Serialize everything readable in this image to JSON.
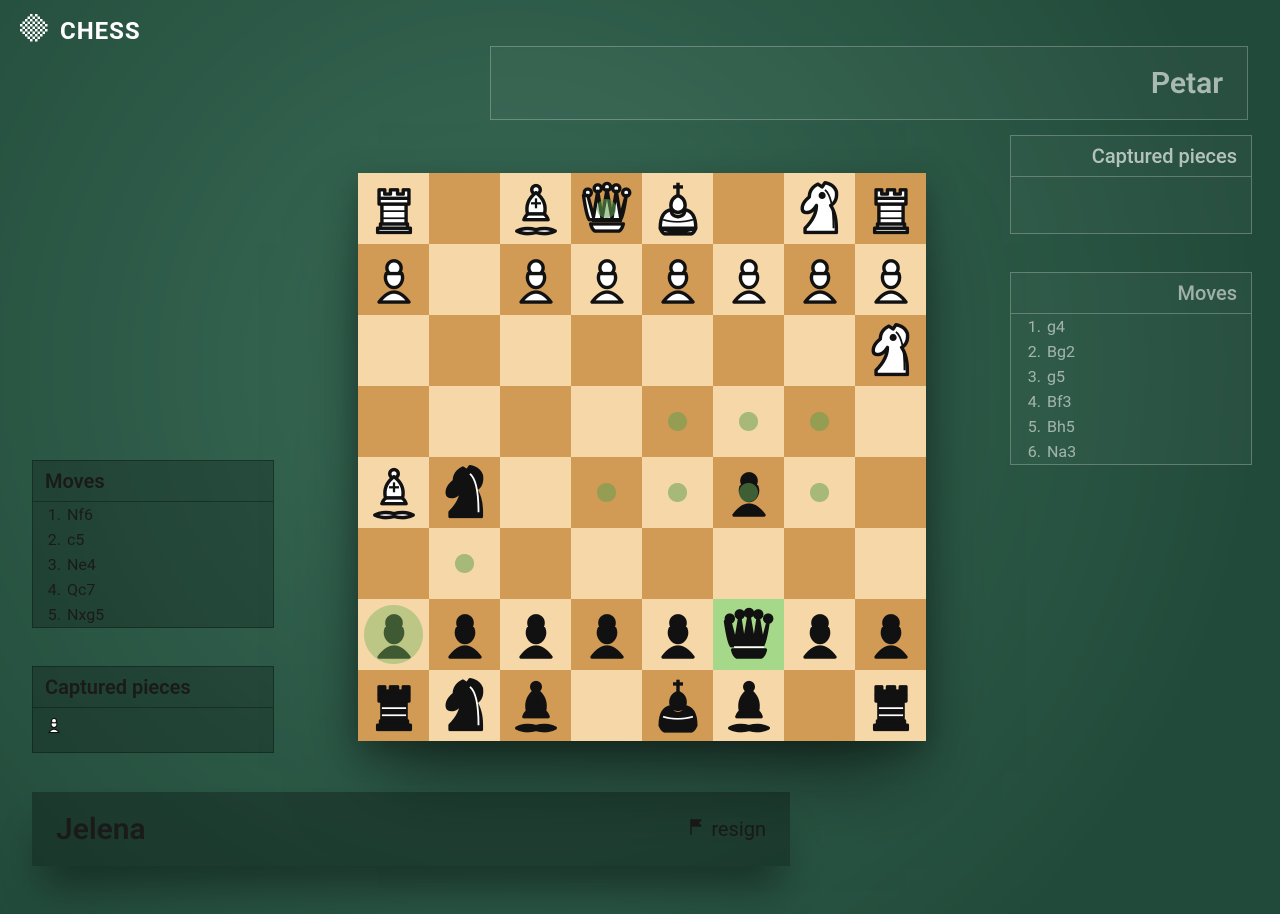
{
  "app": {
    "title": "CHESS"
  },
  "opponent": {
    "name": "Petar",
    "captured_header": "Captured pieces",
    "moves_header": "Moves",
    "moves": [
      "g4",
      "Bg2",
      "g5",
      "Bf3",
      "Bh5",
      "Na3"
    ]
  },
  "player": {
    "name": "Jelena",
    "resign_label": "resign",
    "moves_header": "Moves",
    "moves": [
      "Nf6",
      "c5",
      "Ne4",
      "Qc7",
      "Nxg5"
    ],
    "captured_header": "Captured pieces",
    "captured": [
      {
        "piece": "pawn",
        "color": "white"
      }
    ]
  },
  "board": {
    "orientation": "black",
    "selected_square": "c7",
    "last_move_from": "h7",
    "move_hints": [
      "g6",
      "b5",
      "e5",
      "d5",
      "c5",
      "d4",
      "c4",
      "b4",
      "e1"
    ],
    "pieces": [
      {
        "sq": "a8",
        "piece": "rook",
        "color": "black"
      },
      {
        "sq": "c8",
        "piece": "bishop",
        "color": "black"
      },
      {
        "sq": "d8",
        "piece": "king",
        "color": "black"
      },
      {
        "sq": "f8",
        "piece": "bishop",
        "color": "black"
      },
      {
        "sq": "g8",
        "piece": "knight",
        "color": "black"
      },
      {
        "sq": "h8",
        "piece": "rook",
        "color": "black"
      },
      {
        "sq": "a7",
        "piece": "pawn",
        "color": "black"
      },
      {
        "sq": "b7",
        "piece": "pawn",
        "color": "black"
      },
      {
        "sq": "c7",
        "piece": "queen",
        "color": "black"
      },
      {
        "sq": "d7",
        "piece": "pawn",
        "color": "black"
      },
      {
        "sq": "e7",
        "piece": "pawn",
        "color": "black"
      },
      {
        "sq": "f7",
        "piece": "pawn",
        "color": "black"
      },
      {
        "sq": "g7",
        "piece": "pawn",
        "color": "black"
      },
      {
        "sq": "h7",
        "piece": "pawn",
        "color": "black"
      },
      {
        "sq": "c5",
        "piece": "pawn",
        "color": "black"
      },
      {
        "sq": "g5",
        "piece": "knight",
        "color": "black"
      },
      {
        "sq": "h5",
        "piece": "bishop",
        "color": "white"
      },
      {
        "sq": "a3",
        "piece": "knight",
        "color": "white"
      },
      {
        "sq": "a2",
        "piece": "pawn",
        "color": "white"
      },
      {
        "sq": "b2",
        "piece": "pawn",
        "color": "white"
      },
      {
        "sq": "c2",
        "piece": "pawn",
        "color": "white"
      },
      {
        "sq": "d2",
        "piece": "pawn",
        "color": "white"
      },
      {
        "sq": "e2",
        "piece": "pawn",
        "color": "white"
      },
      {
        "sq": "f2",
        "piece": "pawn",
        "color": "white"
      },
      {
        "sq": "h2",
        "piece": "pawn",
        "color": "white"
      },
      {
        "sq": "a1",
        "piece": "rook",
        "color": "white"
      },
      {
        "sq": "b1",
        "piece": "knight",
        "color": "white"
      },
      {
        "sq": "d1",
        "piece": "king",
        "color": "white"
      },
      {
        "sq": "e1",
        "piece": "queen",
        "color": "white"
      },
      {
        "sq": "f1",
        "piece": "bishop",
        "color": "white"
      },
      {
        "sq": "h1",
        "piece": "rook",
        "color": "white"
      }
    ]
  }
}
